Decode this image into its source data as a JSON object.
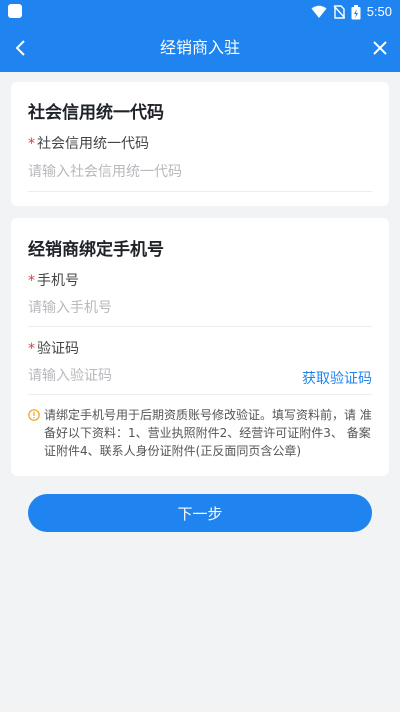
{
  "status_bar": {
    "time": "5:50"
  },
  "header": {
    "title": "经销商入驻"
  },
  "credit_section": {
    "title": "社会信用统一代码",
    "required_mark": "*",
    "field_label": "社会信用统一代码",
    "field_placeholder": "请输入社会信用统一代码",
    "field_value": ""
  },
  "phone_section": {
    "title": "经销商绑定手机号",
    "phone_required_mark": "*",
    "phone_label": "手机号",
    "phone_placeholder": "请输入手机号",
    "phone_value": "",
    "code_required_mark": "*",
    "code_label": "验证码",
    "code_placeholder": "请输入验证码",
    "code_value": "",
    "get_code_label": "获取验证码",
    "notice": "请绑定手机号用于后期资质账号修改验证。填写资料前，请 准备好以下资料：1、营业执照附件2、经营许可证附件3、 备案证附件4、联系人身份证附件(正反面同页含公章)"
  },
  "next_button": {
    "label": "下一步"
  },
  "colors": {
    "primary": "#1f84f0",
    "required": "#e23b3b",
    "notice_icon": "#f0a020"
  }
}
